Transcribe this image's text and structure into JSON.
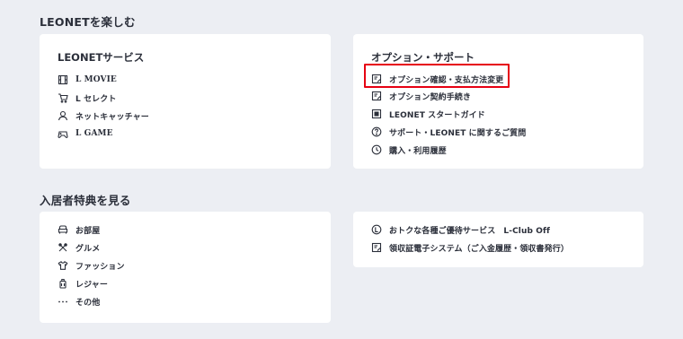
{
  "sections": {
    "enjoy": {
      "title": "LEONETを楽しむ",
      "services": {
        "title": "LEONETサービス",
        "items": [
          {
            "label": "L MOVIE",
            "icon": "film-icon"
          },
          {
            "label": "L セレクト",
            "icon": "cart-icon"
          },
          {
            "label": "ネットキャッチャー",
            "icon": "user-icon"
          },
          {
            "label": "L GAME",
            "icon": "gamepad-icon"
          }
        ]
      },
      "support": {
        "title": "オプション・サポート",
        "items": [
          {
            "label": "オプション確認・支払方法変更",
            "icon": "edit-doc-icon"
          },
          {
            "label": "オプション契約手続き",
            "icon": "edit-doc-icon"
          },
          {
            "label": "LEONET スタートガイド",
            "icon": "guide-icon"
          },
          {
            "label": "サポート・LEONET に関するご質問",
            "icon": "question-icon"
          },
          {
            "label": "購入・利用履歴",
            "icon": "clock-icon"
          }
        ]
      }
    },
    "benefits": {
      "title": "入居者特典を見る",
      "categories": {
        "items": [
          {
            "label": "お部屋",
            "icon": "sofa-icon"
          },
          {
            "label": "グルメ",
            "icon": "cutlery-icon"
          },
          {
            "label": "ファッション",
            "icon": "shirt-icon"
          },
          {
            "label": "レジャー",
            "icon": "luggage-icon"
          },
          {
            "label": "その他",
            "icon": "more-icon"
          }
        ]
      },
      "perks": {
        "items": [
          {
            "label": "おトクな各種ご優待サービス　L-Club Off",
            "icon": "l-circle-icon"
          },
          {
            "label": "領収証電子システム（ご入金履歴・領収書発行）",
            "icon": "edit-doc-icon"
          }
        ]
      }
    }
  },
  "colors": {
    "background": "#eceef3",
    "card": "#ffffff",
    "text": "#2b2f3a",
    "highlight": "#e60012"
  }
}
